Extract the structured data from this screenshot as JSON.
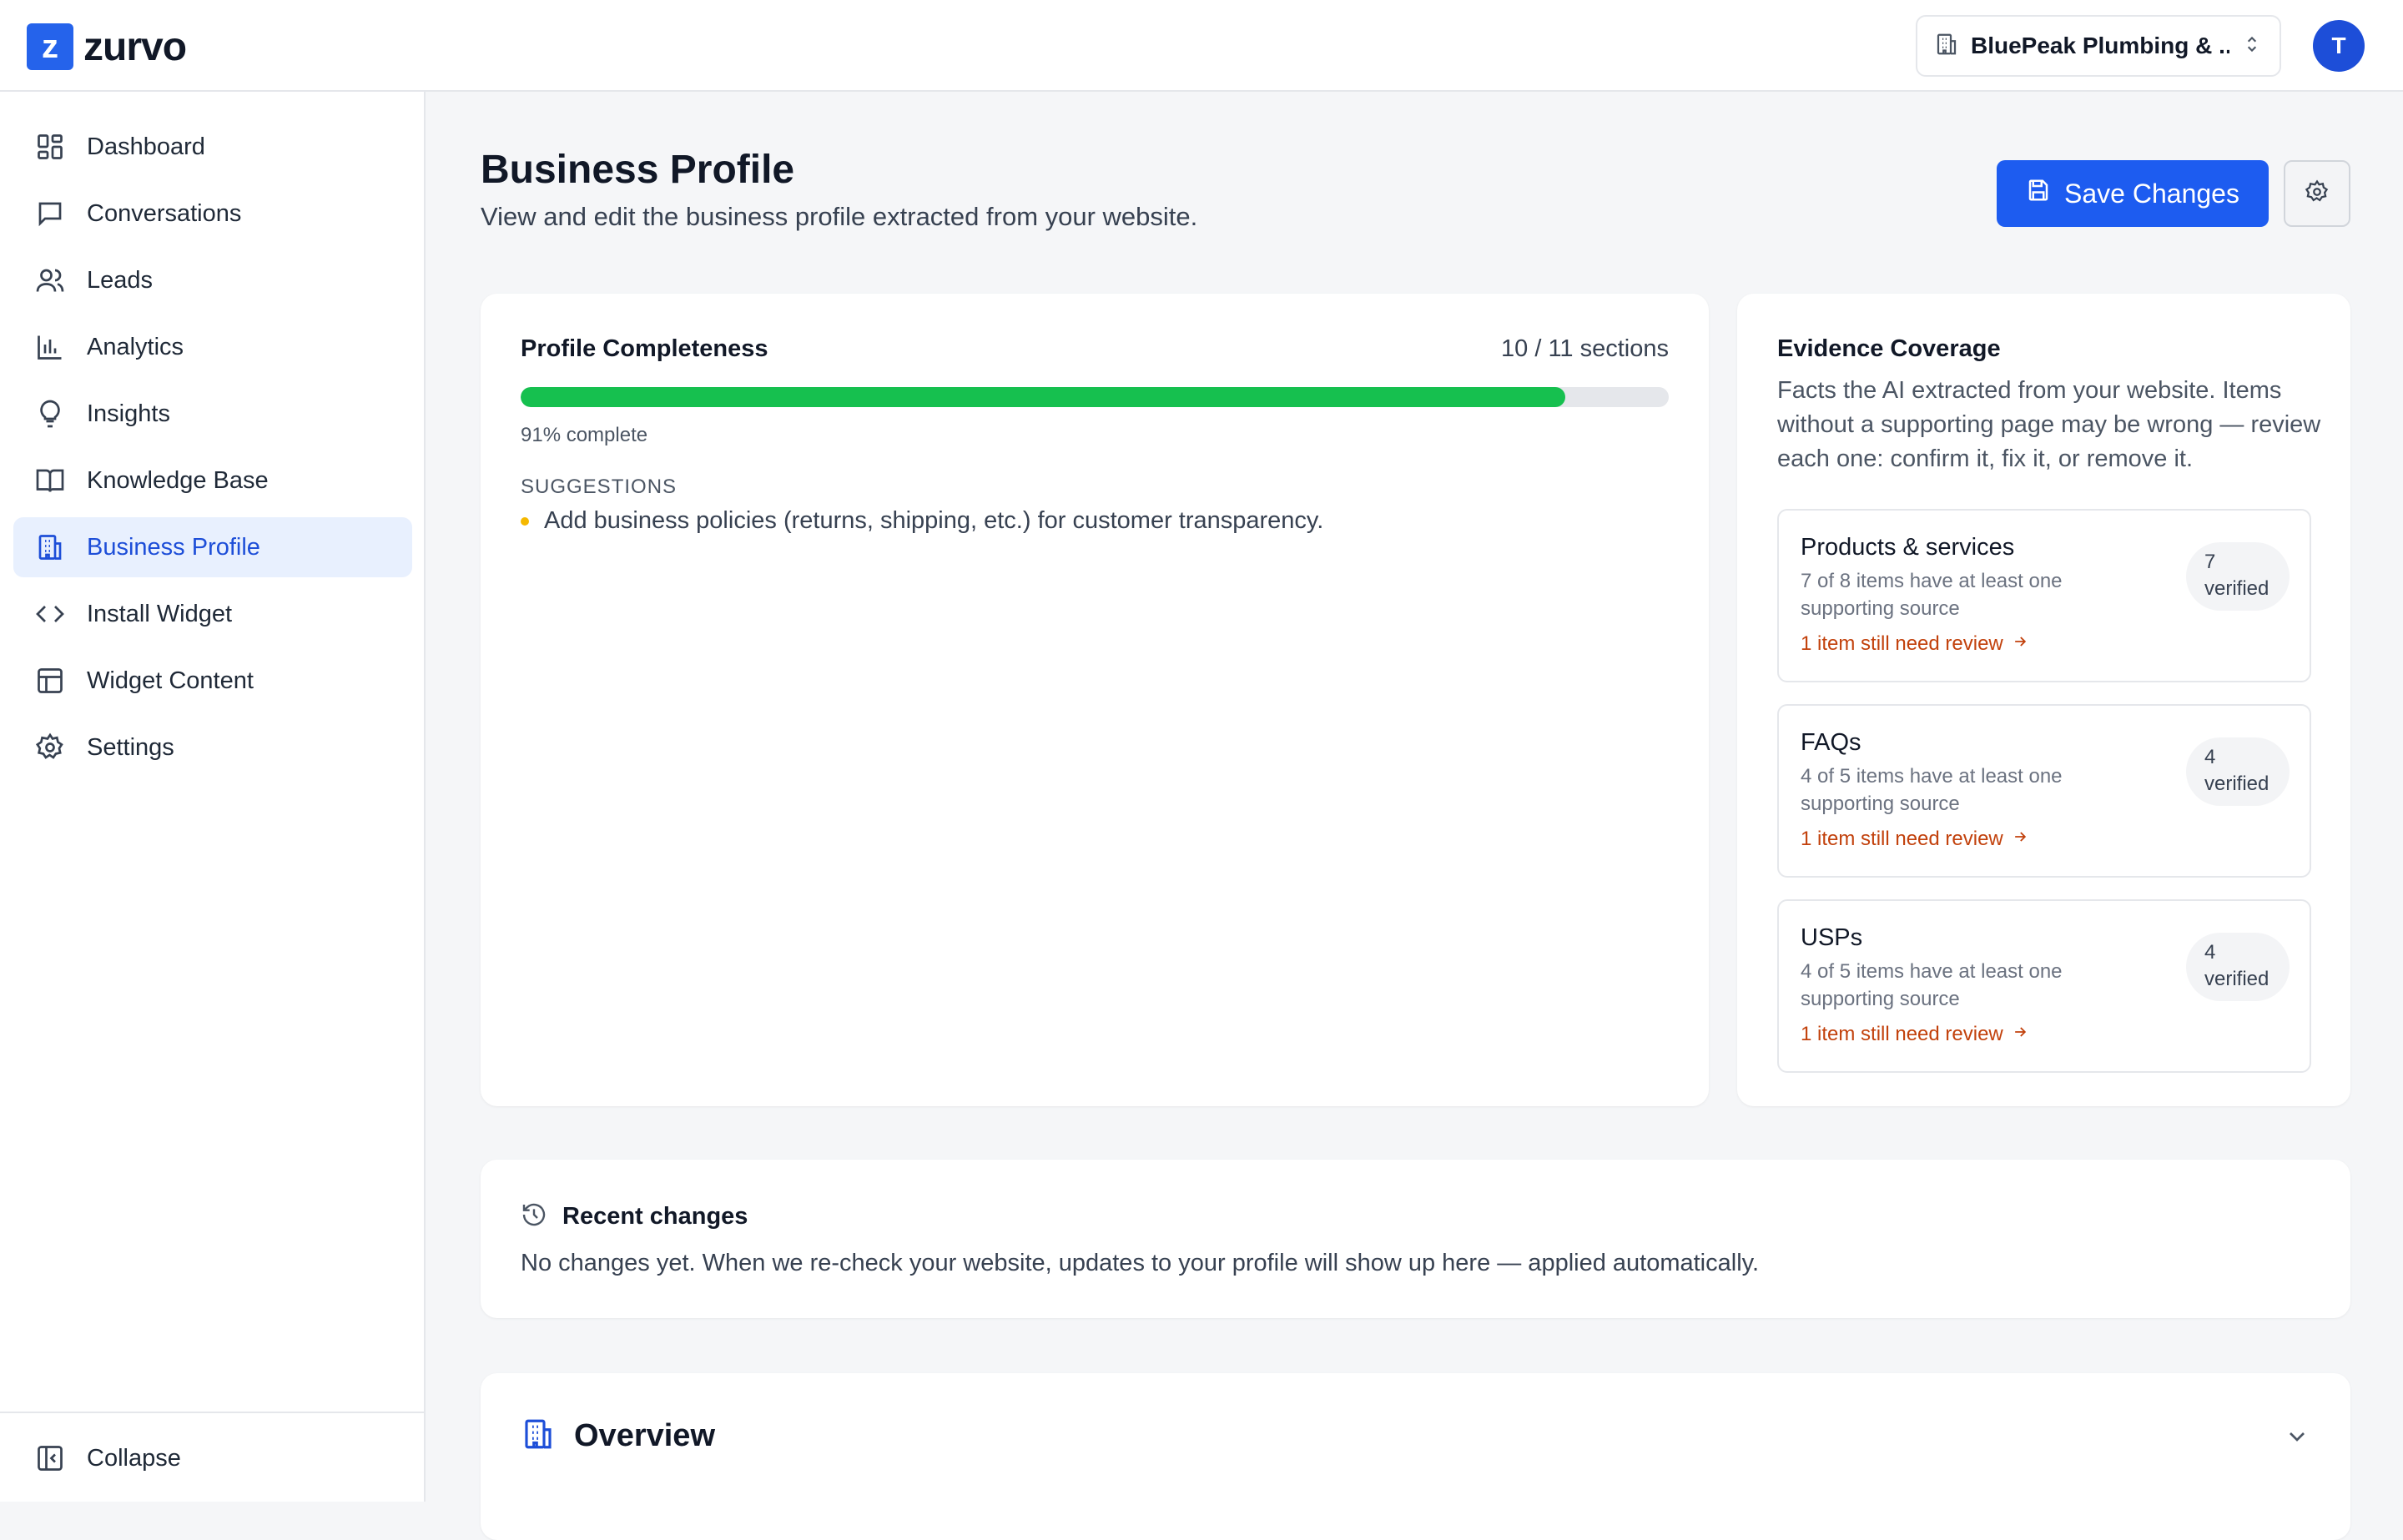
{
  "app": {
    "logo_letter": "z",
    "name": "zurvo",
    "business_select": "BluePeak Plumbing & ...",
    "user_initial": "T",
    "accent": "#1d5cf0"
  },
  "sidebar": {
    "items": [
      {
        "label": "Dashboard",
        "icon": "dashboard-icon"
      },
      {
        "label": "Conversations",
        "icon": "chat-icon"
      },
      {
        "label": "Leads",
        "icon": "users-icon"
      },
      {
        "label": "Analytics",
        "icon": "bar-chart-icon"
      },
      {
        "label": "Insights",
        "icon": "lightbulb-icon"
      },
      {
        "label": "Knowledge Base",
        "icon": "book-icon"
      },
      {
        "label": "Business Profile",
        "icon": "building-icon",
        "active": true
      },
      {
        "label": "Install Widget",
        "icon": "code-icon"
      },
      {
        "label": "Widget Content",
        "icon": "layout-icon"
      },
      {
        "label": "Settings",
        "icon": "gear-icon"
      }
    ],
    "collapse_label": "Collapse"
  },
  "header": {
    "title": "Business Profile",
    "subtitle": "View and edit the business profile extracted from your website.",
    "save_label": "Save Changes"
  },
  "completeness": {
    "title": "Profile Completeness",
    "count": "10 / 11 sections",
    "percent": 91,
    "percent_label": "91% complete",
    "suggestions_heading": "SUGGESTIONS",
    "suggestions": [
      "Add business policies (returns, shipping, etc.) for customer transparency."
    ]
  },
  "evidence": {
    "title": "Evidence Coverage",
    "description": "Facts the AI extracted from your website. Items without a supporting page may be wrong — review each one: confirm it, fix it, or remove it.",
    "items": [
      {
        "name": "Products & services",
        "sub": "7 of 8 items have at least one supporting source",
        "review": "1 item still need review",
        "badge_num": "7",
        "badge_word": "verified"
      },
      {
        "name": "FAQs",
        "sub": "4 of 5 items have at least one supporting source",
        "review": "1 item still need review",
        "badge_num": "4",
        "badge_word": "verified"
      },
      {
        "name": "USPs",
        "sub": "4 of 5 items have at least one supporting source",
        "review": "1 item still need review",
        "badge_num": "4",
        "badge_word": "verified"
      }
    ]
  },
  "recent": {
    "title": "Recent changes",
    "text": "No changes yet. When we re-check your website, updates to your profile will show up here — applied automatically."
  },
  "overview": {
    "title": "Overview"
  }
}
